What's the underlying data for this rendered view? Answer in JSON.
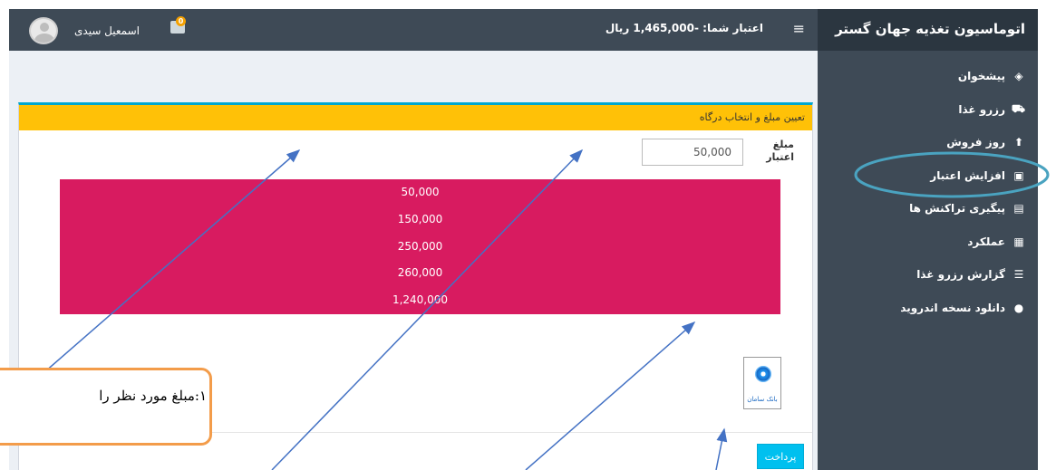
{
  "app": {
    "brand": "اتوماسیون تغذیه جهان گستر"
  },
  "header": {
    "credit": "اعتبار شما: -1,465,000 ریال",
    "username": "اسمعیل سیدی",
    "notif_count": "0"
  },
  "sidebar": {
    "items": [
      {
        "label": "پیشخوان",
        "icon": "dashboard-icon",
        "glyph": "◈"
      },
      {
        "label": "رزرو غذا",
        "icon": "cart-icon",
        "glyph": "🛒"
      },
      {
        "label": "روز فروش",
        "icon": "tag-icon",
        "glyph": "⬆"
      },
      {
        "label": "افزایش اعتبار",
        "icon": "money-icon",
        "glyph": "▣"
      },
      {
        "label": "پیگیری تراکنش ها",
        "icon": "document-icon",
        "glyph": "▤"
      },
      {
        "label": "عملکرد",
        "icon": "table-icon",
        "glyph": "▦"
      },
      {
        "label": "گزارش رزرو غذا",
        "icon": "list-icon",
        "glyph": "☰"
      },
      {
        "label": "دانلود نسخه اندروید",
        "icon": "android-icon",
        "glyph": "●"
      }
    ]
  },
  "panel": {
    "header": "تعیین مبلغ و انتخاب درگاه",
    "amount_label": "مبلغ اعتبار",
    "amount_value": "50,000",
    "options": [
      "50,000",
      "150,000",
      "250,000",
      "260,000",
      "1,240,000"
    ],
    "bank_name": "بانک سامان",
    "pay_label": "پرداخت"
  },
  "annotation": {
    "callout": "۱:مبلغ مورد نظر را",
    "colors": {
      "arrow": "#4472c4",
      "highlight": "#4aa3c0",
      "callout_border": "#f39c4a"
    }
  }
}
